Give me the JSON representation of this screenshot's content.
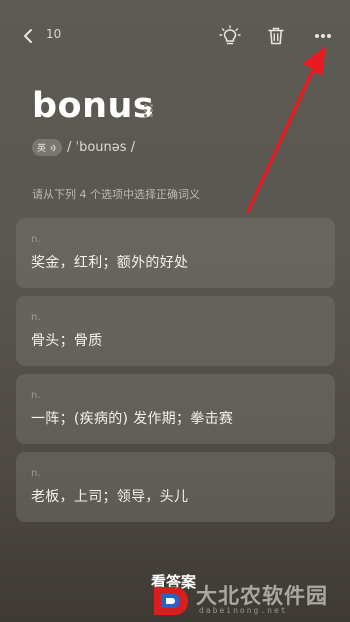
{
  "header": {
    "count": "10",
    "back_icon": "chevron-left-icon",
    "hint_icon": "lightbulb-icon",
    "delete_icon": "trash-icon",
    "more_icon": "more-horizontal-icon"
  },
  "word": {
    "text": "bonus",
    "accent": "英",
    "speaker_icon": "speaker-icon",
    "phonetic": "/ ˈbounəs /"
  },
  "instruction": "请从下列 4 个选项中选择正确词义",
  "options": [
    {
      "pos": "n.",
      "meaning": "奖金，红利；额外的好处"
    },
    {
      "pos": "n.",
      "meaning": "骨头；骨质"
    },
    {
      "pos": "n.",
      "meaning": "一阵；(疾病的) 发作期；拳击赛"
    },
    {
      "pos": "n.",
      "meaning": "老板，上司；领导，头儿"
    }
  ],
  "answer_link": "看答案",
  "watermark": {
    "text": "大北农软件园",
    "url": "dabeinong.net"
  },
  "colors": {
    "annotation_arrow": "#e8191f",
    "watermark_logo_red": "#d81e1e",
    "watermark_logo_blue": "#2a62c9"
  }
}
